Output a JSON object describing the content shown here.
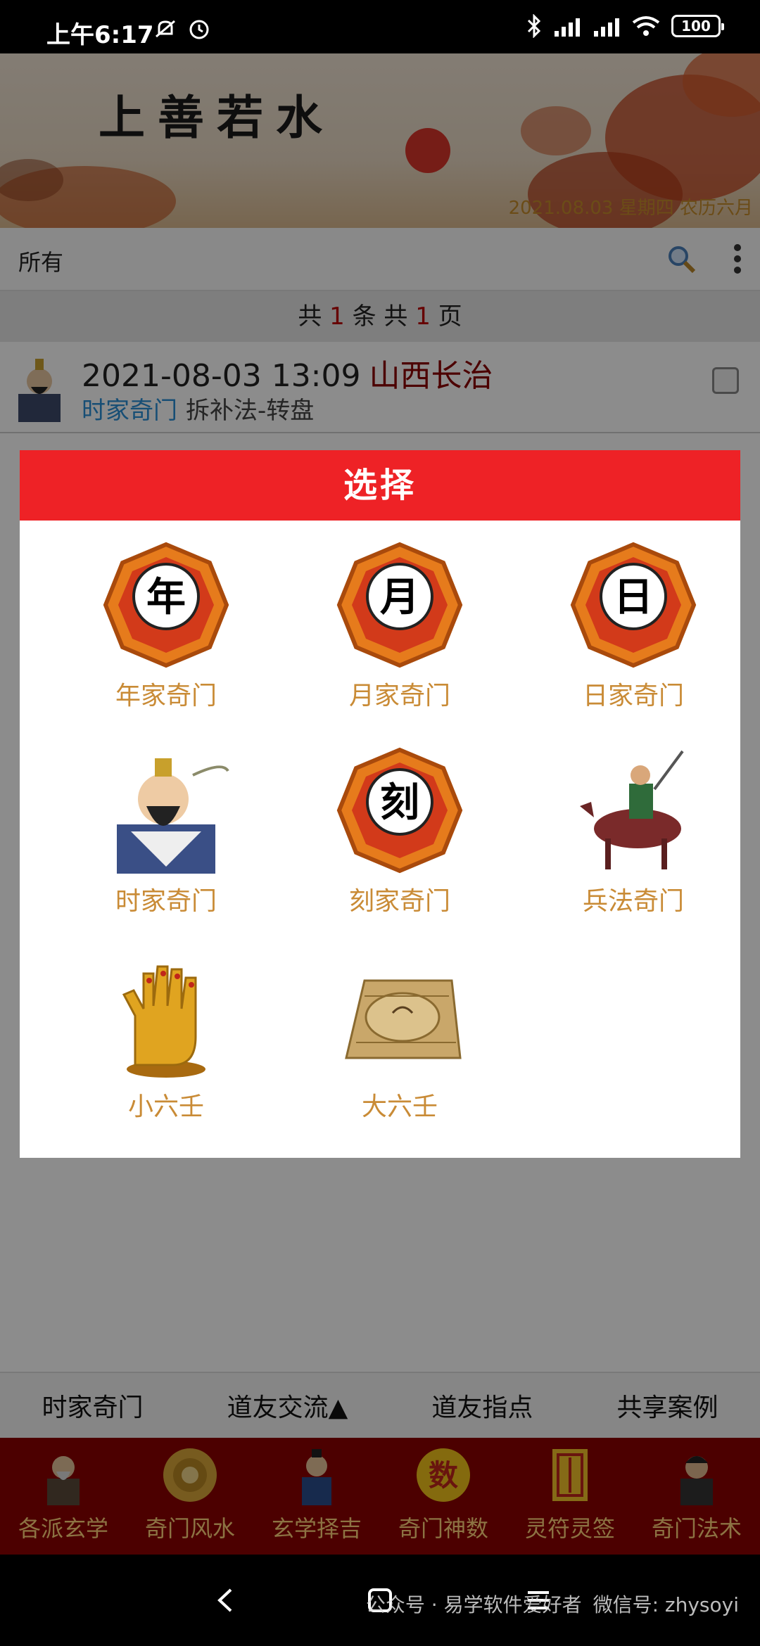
{
  "status_bar": {
    "time": "上午6:17",
    "icons": [
      "bell-muted-icon",
      "alarm-icon",
      "bluetooth-icon",
      "hd-signal-icon",
      "signal-icon",
      "wifi-icon"
    ],
    "battery": "100"
  },
  "banner": {
    "title": "上善若水",
    "date_text": "2021.08.03 星期四 农历六月"
  },
  "filter_bar": {
    "label": "所有",
    "icons": [
      "search-icon",
      "more-vert-icon"
    ]
  },
  "pager": {
    "prefix": "共",
    "records": "1",
    "middle": "条 共",
    "pages": "1",
    "suffix": "页"
  },
  "record": {
    "datetime": "2021-08-03 13:09",
    "place": "山西长治",
    "type": "时家奇门",
    "method": "拆补法-转盘"
  },
  "dialog": {
    "title": "选择",
    "options": [
      {
        "label": "年家奇门",
        "glyph": "年",
        "icon": "bagua-year-icon"
      },
      {
        "label": "月家奇门",
        "glyph": "月",
        "icon": "bagua-month-icon"
      },
      {
        "label": "日家奇门",
        "glyph": "日",
        "icon": "bagua-day-icon"
      },
      {
        "label": "时家奇门",
        "icon": "sage-portrait-icon"
      },
      {
        "label": "刻家奇门",
        "glyph": "刻",
        "icon": "bagua-quarter-icon"
      },
      {
        "label": "兵法奇门",
        "icon": "warrior-horse-icon"
      },
      {
        "label": "小六壬",
        "icon": "golden-hand-icon"
      },
      {
        "label": "大六壬",
        "icon": "compass-board-icon"
      }
    ]
  },
  "tabs": [
    "时家奇门",
    "道友交流▲",
    "道友指点",
    "共享案例"
  ],
  "bottom_nav": [
    {
      "label": "各派玄学",
      "icon": "sage-icon"
    },
    {
      "label": "奇门风水",
      "icon": "luopan-icon"
    },
    {
      "label": "玄学择吉",
      "icon": "scholar-icon"
    },
    {
      "label": "奇门神数",
      "icon": "shu-badge-icon",
      "glyph": "数"
    },
    {
      "label": "灵符灵签",
      "icon": "talisman-icon"
    },
    {
      "label": "奇门法术",
      "icon": "master-icon"
    }
  ],
  "system_nav": {
    "watermark_1": "公众号 · 易学软件爱好者",
    "watermark_2": "微信号: zhysoyi"
  },
  "colors": {
    "dialog_header": "#ee2226",
    "option_label": "#c98b36",
    "nav_bg": "#8b0000",
    "nav_label": "#ffd27a"
  }
}
